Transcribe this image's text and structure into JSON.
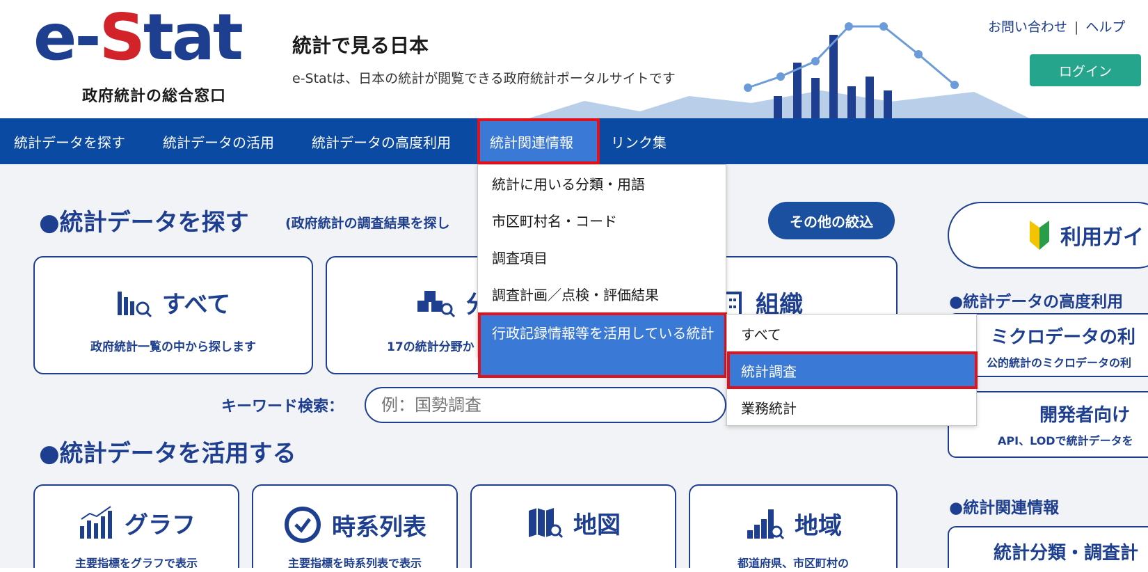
{
  "header": {
    "logo_e": "e-",
    "logo_s": "S",
    "logo_rest": "tat",
    "logo_sub": "政府統計の総合窓口",
    "tagline_title": "統計で見る日本",
    "tagline_sub": "e-Statは、日本の統計が閲覧できる政府統計ポータルサイトです",
    "contact_link": "お問い合わせ",
    "link_separator": "|",
    "help_link": "ヘルプ",
    "login_label": "ログイン"
  },
  "nav": {
    "items": [
      {
        "label": "統計データを探す"
      },
      {
        "label": "統計データの活用"
      },
      {
        "label": "統計データの高度利用"
      },
      {
        "label": "統計関連情報"
      },
      {
        "label": "リンク集"
      }
    ]
  },
  "dropdown": {
    "items": [
      {
        "label": "統計に用いる分類・用語"
      },
      {
        "label": "市区町村名・コード"
      },
      {
        "label": "調査項目"
      },
      {
        "label": "調査計画／点検・評価結果"
      },
      {
        "label": "行政記録情報等を活用している統計"
      }
    ]
  },
  "submenu": {
    "items": [
      {
        "label": "すべて"
      },
      {
        "label": "統計調査"
      },
      {
        "label": "業務統計"
      }
    ]
  },
  "search_section": {
    "title": "●統計データを探す",
    "note": "(政府統計の調査結果を探し",
    "filter_button": "その他の絞込",
    "cards": [
      {
        "title": "すべて",
        "desc": "政府統計一覧の中から探します"
      },
      {
        "title": "分",
        "desc": "17の統計分野か"
      },
      {
        "title": "組織",
        "desc": ""
      }
    ],
    "keyword_label": "キーワード検索：",
    "keyword_placeholder": "例：国勢調査"
  },
  "use_section": {
    "title": "●統計データを活用する",
    "cards": [
      {
        "title": "グラフ",
        "desc": "主要指標をグラフで表示"
      },
      {
        "title": "時系列表",
        "desc": "主要指標を時系列表で表示"
      },
      {
        "title": "地図",
        "desc": ""
      },
      {
        "title": "地域",
        "desc": "都道府県、市区町村の"
      }
    ]
  },
  "sidebar": {
    "guide_label": "利用ガイド",
    "advanced_title": "●統計データの高度利用",
    "micro_title": "ミクロデータの利",
    "micro_desc": "公的統計のミクロデータの利",
    "dev_title": "開発者向け",
    "dev_desc": "API、LODで統計データを",
    "related_title": "●統計関連情報",
    "related_card_title": "統計分類・調査計"
  },
  "colors": {
    "brand_navy": "#1e3f8f",
    "brand_red": "#d2232a",
    "nav_bg": "#0b4aa2",
    "highlight": "#3b79d6",
    "focus_outline": "#e3111b",
    "login_green": "#25a58c",
    "page_bg": "#f1f3f6"
  }
}
